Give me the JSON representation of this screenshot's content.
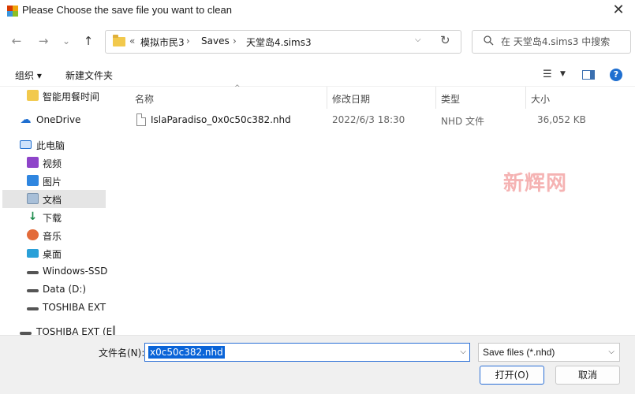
{
  "window": {
    "title": "Please Choose the save file you want to clean",
    "close_glyph": "✕"
  },
  "nav": {
    "back_glyph": "←",
    "forward_glyph": "→",
    "recent_glyph": "⌄",
    "up_glyph": "↑"
  },
  "address": {
    "overflow": "«",
    "crumbs": [
      "模拟市民3",
      "Saves",
      "天堂岛4.sims3"
    ],
    "separator": "›",
    "dropdown_glyph": "⌵",
    "refresh_glyph": "↻"
  },
  "search": {
    "placeholder": "在 天堂岛4.sims3 中搜索",
    "icon": "search-icon"
  },
  "toolbar": {
    "organize_label": "组织 ▾",
    "new_folder_label": "新建文件夹",
    "view_glyph": "☰",
    "view_dropdown": "▼",
    "help_glyph": "?"
  },
  "sidebar": {
    "items": [
      {
        "label": "智能用餐时间",
        "icon": "folder-icon"
      },
      {
        "label": "OneDrive",
        "icon": "cloud-icon"
      },
      {
        "label": "此电脑",
        "icon": "computer-icon"
      },
      {
        "label": "视频",
        "icon": "video-icon"
      },
      {
        "label": "图片",
        "icon": "image-icon"
      },
      {
        "label": "文档",
        "icon": "document-icon"
      },
      {
        "label": "下载",
        "icon": "download-icon"
      },
      {
        "label": "音乐",
        "icon": "music-icon"
      },
      {
        "label": "桌面",
        "icon": "desktop-icon"
      },
      {
        "label": "Windows-SSD",
        "icon": "drive-icon"
      },
      {
        "label": "Data (D:)",
        "icon": "drive-icon"
      },
      {
        "label": "TOSHIBA EXT",
        "icon": "drive-icon"
      },
      {
        "label": "TOSHIBA EXT (E",
        "icon": "drive-icon"
      }
    ],
    "selected": "文档"
  },
  "filelist": {
    "columns": [
      "名称",
      "修改日期",
      "类型",
      "大小"
    ],
    "sort_glyph": "^",
    "rows": [
      {
        "name": "IslaParadiso_0x0c50c382.nhd",
        "modified": "2022/6/3 18:30",
        "type": "NHD 文件",
        "size": "36,052 KB"
      }
    ]
  },
  "watermark": "新辉网",
  "footer": {
    "filename_label": "文件名(N):",
    "filename_value": "x0c50c382.nhd",
    "dropdown_glyph": "⌵",
    "filetype_value": "Save files (*.nhd)",
    "open_label": "打开(O)",
    "cancel_label": "取消"
  },
  "colors": {
    "accent": "#2a6fd6",
    "selection": "#0a64d8",
    "watermark": "#f29a9a"
  }
}
